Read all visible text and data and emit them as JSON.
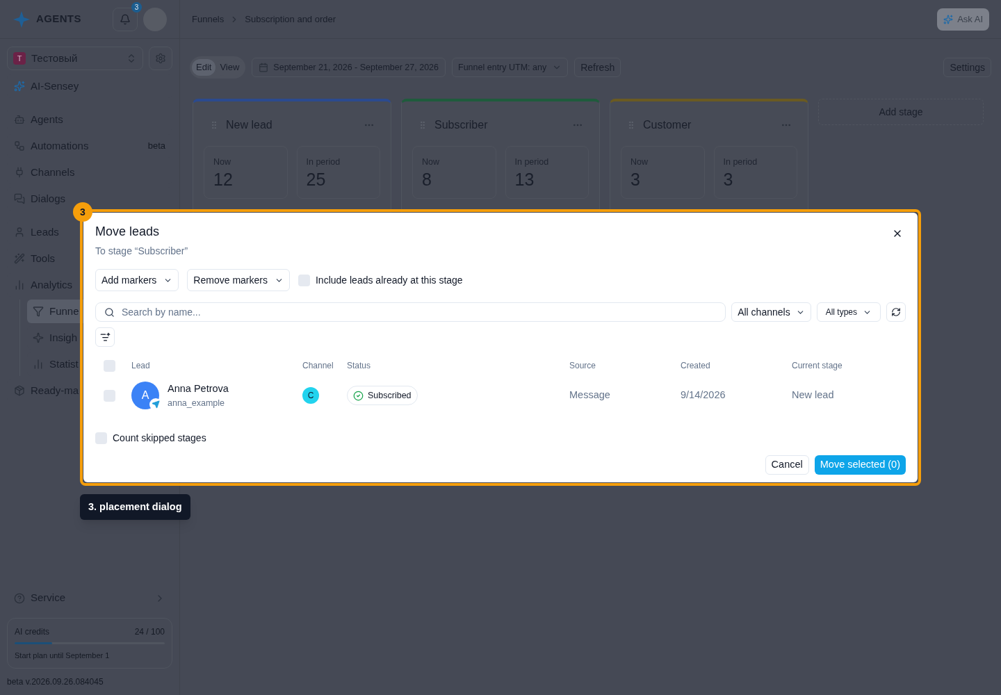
{
  "header": {
    "logo_text": "AGENTS",
    "notifications_count": "3",
    "breadcrumbs": [
      "Funnels",
      "Subscription and order"
    ],
    "ask_ai": "Ask AI"
  },
  "sidebar": {
    "workspace": {
      "initial": "T",
      "name": "Тестовый"
    },
    "groups": [
      [
        {
          "label": "AI-Sensey",
          "selected": false
        }
      ],
      [
        {
          "label": "Agents",
          "selected": false
        },
        {
          "label": "Automations",
          "badge": "beta",
          "selected": false
        },
        {
          "label": "Channels",
          "selected": false
        },
        {
          "label": "Dialogs",
          "selected": false
        }
      ],
      [
        {
          "label": "Leads",
          "selected": false
        },
        {
          "label": "Tools",
          "selected": false
        },
        {
          "label": "Analytics",
          "selected": false,
          "children": [
            {
              "label": "Funne",
              "selected": true
            },
            {
              "label": "Insigh",
              "selected": false
            },
            {
              "label": "Statist",
              "selected": false
            }
          ]
        },
        {
          "label": "Ready-ma",
          "selected": false
        }
      ]
    ],
    "service": "Service",
    "credits": {
      "label": "AI credits",
      "value": "24 / 100",
      "level": 0.25,
      "plan": "Start plan until September 1"
    },
    "version": "beta v.2026.09.26.084045"
  },
  "toolbar": {
    "modes": [
      {
        "label": "Edit",
        "selected": true
      },
      {
        "label": "View",
        "selected": false
      }
    ],
    "date_range": "September 21, 2026 - September 27, 2026",
    "utm_filter": "Funnel entry UTM: any",
    "refresh": "Refresh",
    "settings": "Settings"
  },
  "stages": [
    {
      "name": "New lead",
      "color": "#2b4a8e",
      "now_label": "Now",
      "now": "12",
      "period_label": "In period",
      "period": "25"
    },
    {
      "name": "Subscriber",
      "color": "#1f5b3c",
      "now_label": "Now",
      "now": "8",
      "period_label": "In period",
      "period": "13"
    },
    {
      "name": "Customer",
      "color": "#6a5a22",
      "now_label": "Now",
      "now": "3",
      "period_label": "In period",
      "period": "3"
    }
  ],
  "add_stage": "Add stage",
  "dialog": {
    "title": "Move leads",
    "subtitle": "To stage “Subscriber”",
    "add_markers": "Add markers",
    "remove_markers": "Remove markers",
    "include": {
      "label": "Include leads already at this stage",
      "checked": false
    },
    "search": {
      "placeholder": "Search by name..."
    },
    "channels_filter": "All channels",
    "types_filter": "All types",
    "select_all": false,
    "columns": [
      "Lead",
      "Channel",
      "Status",
      "Source",
      "Created",
      "Current stage"
    ],
    "rows": [
      {
        "avatar": "A",
        "name": "Anna Petrova",
        "username": "anna_example",
        "channel": "C",
        "status": "Subscribed",
        "source": "Message",
        "created": "9/14/2026",
        "stage": "New lead",
        "selected": false
      }
    ],
    "count_skipped": {
      "label": "Count skipped stages",
      "checked": false
    },
    "cancel": "Cancel",
    "move": "Move selected (0)"
  },
  "annotation": {
    "number": "3",
    "label": "3. placement dialog"
  }
}
